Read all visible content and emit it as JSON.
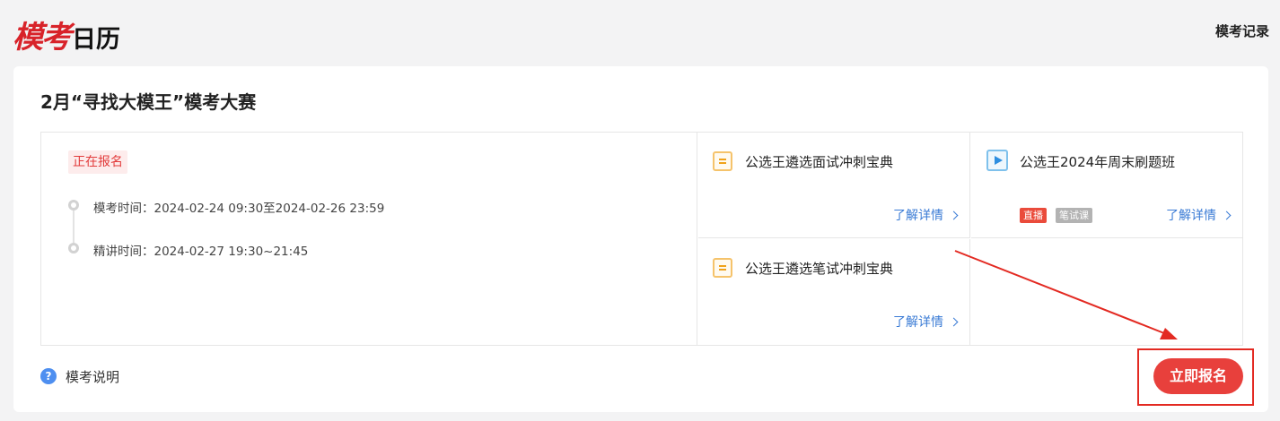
{
  "header": {
    "logo_red": "模考",
    "logo_black": "日历",
    "records_link": "模考记录"
  },
  "exam": {
    "title": "2月“寻找大模王”模考大赛",
    "status_badge": "正在报名",
    "timeline": [
      {
        "label": "模考时间：",
        "value": "2024-02-24 09:30至2024-02-26 23:59"
      },
      {
        "label": "精讲时间：",
        "value": "2024-02-27 19:30~21:45"
      }
    ]
  },
  "resources": [
    {
      "icon": "document-icon",
      "title": "公选王遴选面试冲刺宝典",
      "link": "了解详情"
    },
    {
      "icon": "video-play-icon",
      "title": "公选王2024年周末刷题班",
      "link": "了解详情",
      "tags": [
        "直播",
        "笔试课"
      ]
    },
    {
      "icon": "document-icon",
      "title": "公选王遴选笔试冲刺宝典",
      "link": "了解详情"
    }
  ],
  "footer": {
    "help_icon_glyph": "?",
    "explain_label": "模考说明",
    "signup_button": "立即报名"
  },
  "colors": {
    "brand_red": "#d8232a",
    "button_red": "#e8403c",
    "link_blue": "#3a7bd5",
    "annotation_red": "#e32a22"
  }
}
